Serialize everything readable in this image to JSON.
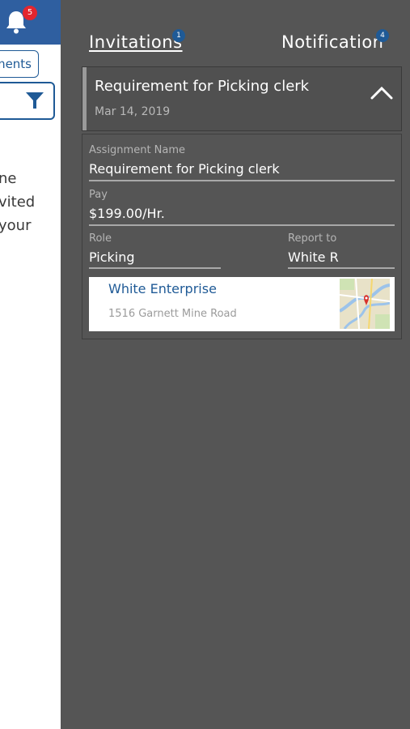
{
  "left_screen": {
    "notification_count": "5",
    "assignments_button_partial": "ments",
    "message_lines": [
      "ne",
      "vited",
      " your"
    ]
  },
  "drawer": {
    "tabs": [
      {
        "label": "Invitations",
        "badge": "1"
      },
      {
        "label": "Notification",
        "badge": "4"
      }
    ],
    "invitation": {
      "title": "Requirement for Picking clerk",
      "date": "Mar 14, 2019",
      "fields": {
        "assignment_name_label": "Assignment Name",
        "assignment_name_value": "Requirement for Picking clerk",
        "pay_label": "Pay",
        "pay_value": "$199.00/Hr.",
        "role_label": "Role",
        "role_value": "Picking",
        "report_to_label": "Report to",
        "report_to_value": "White R"
      },
      "location": {
        "company": "White Enterprise",
        "address": "1516 Garnett Mine Road"
      }
    }
  },
  "colors": {
    "brand_blue": "#1f5a96",
    "header_blue": "#2f5fa0",
    "badge_red": "#e3262f",
    "drawer_bg": "#555555"
  }
}
